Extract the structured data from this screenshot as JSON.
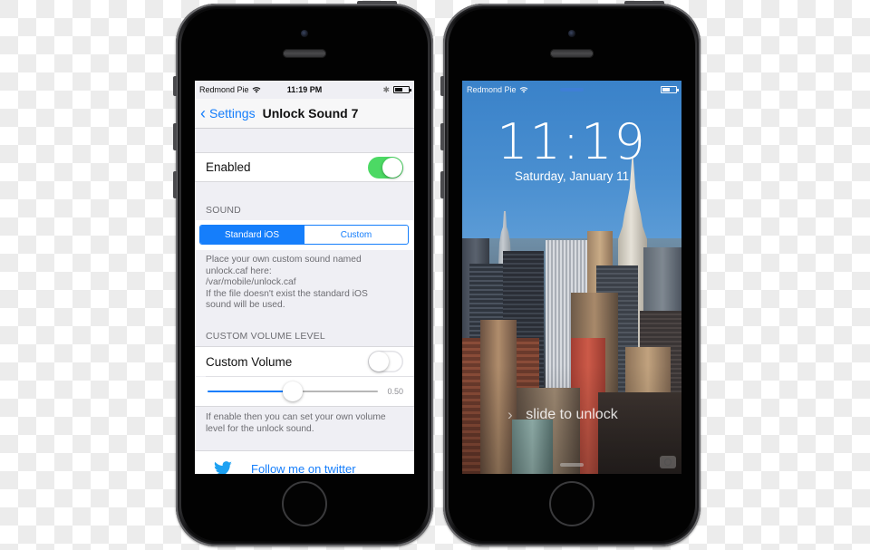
{
  "left_phone": {
    "status_bar": {
      "carrier": "Redmond Pie",
      "wifi_icon": "wifi-icon",
      "time": "11:19 PM",
      "bluetooth_icon": "bluetooth-icon",
      "battery_icon": "battery-icon"
    },
    "nav_bar": {
      "back_label": "Settings",
      "back_icon": "chevron-left-icon",
      "title": "Unlock Sound 7"
    },
    "enabled": {
      "label": "Enabled",
      "state": "on"
    },
    "sound_section": {
      "header": "SOUND",
      "segments": [
        {
          "label": "Standard iOS",
          "selected": true
        },
        {
          "label": "Custom",
          "selected": false
        }
      ],
      "footer_lines": [
        "Place your own custom sound named",
        "unlock.caf here:",
        "/var/mobile/unlock.caf",
        "If the file doesn't exist the standard iOS",
        "sound will be used."
      ]
    },
    "volume_section": {
      "header": "CUSTOM VOLUME LEVEL",
      "toggle_label": "Custom Volume",
      "toggle_state": "off",
      "slider_value": 0.5,
      "slider_value_label": "0.50",
      "footer_lines": [
        "If enable then you can set your own volume",
        "level for the unlock sound."
      ]
    },
    "twitter": {
      "icon": "twitter-bird-icon",
      "label": "Follow me on twitter"
    },
    "colors": {
      "tint": "#157efb",
      "toggle_on": "#4cd964",
      "group_background": "#efeff4"
    }
  },
  "right_phone": {
    "status_bar": {
      "carrier": "Redmond Pie",
      "wifi_icon": "wifi-icon",
      "battery_icon": "battery-icon"
    },
    "clock": "11:19",
    "date": "Saturday, January 11",
    "slide_to_unlock": "slide to unlock",
    "slide_icon": "chevron-right-icon",
    "camera_icon": "camera-icon",
    "wallpaper": "new-york-skyline"
  }
}
